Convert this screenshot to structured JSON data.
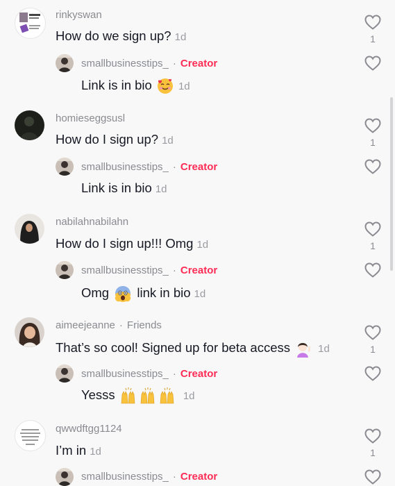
{
  "comments": [
    {
      "username": "rinkyswan",
      "text": "How do we sign up?",
      "age": "1d",
      "likes": "1",
      "reply": {
        "username": "smallbusinesstips_",
        "badge": "Creator",
        "text": "Link is in bio",
        "age": "1d"
      }
    },
    {
      "username": "homieseggsusl",
      "text": "How do I sign up?",
      "age": "1d",
      "likes": "1",
      "reply": {
        "username": "smallbusinesstips_",
        "badge": "Creator",
        "text": "Link is in bio",
        "age": "1d"
      }
    },
    {
      "username": "nabilahnabilahn",
      "text": "How do I sign up!!! Omg",
      "age": "1d",
      "likes": "1",
      "reply": {
        "username": "smallbusinesstips_",
        "badge": "Creator",
        "text_before": "Omg",
        "text_after": "link in bio",
        "age": "1d"
      }
    },
    {
      "username": "aimeejeanne",
      "tag": "Friends",
      "text": "That’s so cool! Signed up for beta access",
      "age": "1d",
      "likes": "1",
      "reply": {
        "username": "smallbusinesstips_",
        "badge": "Creator",
        "text": "Yesss",
        "age": "1d"
      }
    },
    {
      "username": "qwwdftgg1124",
      "text": "I’m in",
      "age": "1d",
      "likes": "1",
      "reply": {
        "username": "smallbusinesstips_",
        "badge": "Creator"
      }
    }
  ],
  "icons": {
    "like": "heart-outline-icon",
    "reply_emoji_1": "smiling-face-with-hearts-emoji",
    "reply_emoji_3": "screaming-face-emoji",
    "comment_emoji_4": "person-tipping-hand-emoji",
    "reply_emoji_4": "raised-hands-emoji"
  },
  "colors": {
    "creator": "#fe2c55",
    "muted": "#8a8b91",
    "text": "#161823",
    "background": "#f8f8f8"
  }
}
